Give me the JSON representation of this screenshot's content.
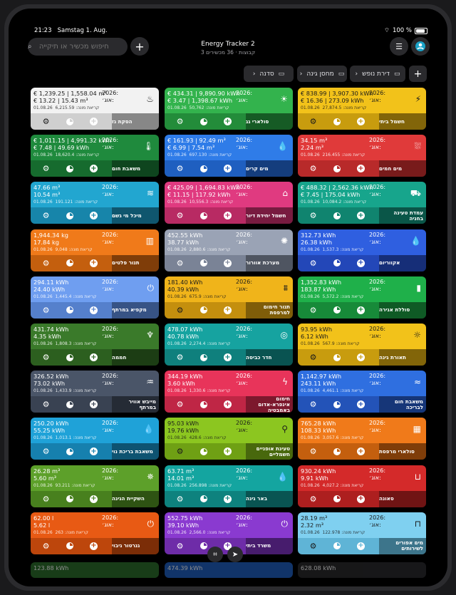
{
  "status": {
    "time": "21:23",
    "date": "Samstag 1. Aug.",
    "battery": "100 %",
    "wifi_icon": "wifi-icon",
    "battery_icon": "battery-icon"
  },
  "header": {
    "title": "Energy Tracker 2",
    "subtitle": "3 קבוצות · 36 מכשירים",
    "search_placeholder": "חיפוש מכשיר או תיקייה"
  },
  "folders": [
    {
      "label": "דירת נופש"
    },
    {
      "label": "מחסן גינה"
    },
    {
      "label": "סדנה"
    }
  ],
  "common": {
    "year_label": "2026:",
    "month_label": "אוג׳:",
    "date": "01.08.26",
    "reading_label": "קריאת מונה:"
  },
  "cards": [
    {
      "name": "הסקת גז",
      "v1": "€ 1,239.25 | 1,558.04 m³",
      "v2": "€ 13.22 | 15.43 m³",
      "reading": "6,215.59",
      "icon": "flame-icon",
      "color_top": "#f2f2f2",
      "color_bottom": "#cfcfcf",
      "dark": true
    },
    {
      "name": "סולארי גג",
      "v1": "€ 434.31 | 9,890.90 kWh",
      "v2": "€ 3.47 | 1,398.67 kWh",
      "reading": "50,762",
      "icon": "sun-icon",
      "color_top": "#33b34d",
      "color_bottom": "#238c3a"
    },
    {
      "name": "חשמל ביתי",
      "v1": "€ 838.99 | 3,907.30 kWh",
      "v2": "€ 16.36 | 273.09 kWh",
      "reading": "27,874.5",
      "icon": "bolt-icon",
      "color_top": "#f2c21a",
      "color_bottom": "#c89c0e",
      "dark": true
    },
    {
      "name": "משאבת חום",
      "v1": "€ 1,011.15 | 4,991.32 kWh",
      "v2": "€ 7.48 | 49.69 kWh",
      "reading": "18,620.4",
      "icon": "thermometer-icon",
      "color_top": "#1f8a3d",
      "color_bottom": "#166b2e"
    },
    {
      "name": "מים קרים",
      "v1": "€ 161.93 | 92.49 m³",
      "v2": "€ 6.99 | 7.54 m³",
      "reading": "697.130",
      "icon": "water-drops-icon",
      "color_top": "#2f7ce8",
      "color_bottom": "#1f5fc0"
    },
    {
      "name": "מים חמים",
      "v1": "34.15 m³",
      "v2": "2.24 m³",
      "reading": "216.455",
      "icon": "shower-icon",
      "color_top": "#e03a3a",
      "color_bottom": "#b82a2a"
    },
    {
      "name": "מיכל מי גשם",
      "v1": "47.66 m³",
      "v2": "10.54 m³",
      "reading": "191.121",
      "icon": "waves-icon",
      "color_top": "#22a6d0",
      "color_bottom": "#1785aa"
    },
    {
      "name": "חשמל יחידת דיור",
      "v1": "€ 425.09 | 1,694.83 kWh",
      "v2": "€ 11.15 | 117.92 kWh",
      "reading": "10,556.3",
      "icon": "house-icon",
      "color_top": "#e03a80",
      "color_bottom": "#b82a63"
    },
    {
      "name": "עמדת טעינה בחניה",
      "v1": "€ 488.32 | 2,562.36 kWh",
      "v2": "€ 7.45 | 175.04 kWh",
      "reading": "10,084.2",
      "icon": "car-icon",
      "color_top": "#17a58c",
      "color_bottom": "#10846f"
    },
    {
      "name": "תנור פלטים",
      "v1": "1,944.34 kg",
      "v2": "17.84 kg",
      "reading": "9,048",
      "icon": "pellet-stove-icon",
      "color_top": "#f07a1a",
      "color_bottom": "#c45f0e"
    },
    {
      "name": "מערכת אוורור",
      "v1": "452.55 kWh",
      "v2": "38.77 kWh",
      "reading": "2,880.6",
      "icon": "fan-icon",
      "color_top": "#9aa3b5",
      "color_bottom": "#7a8396"
    },
    {
      "name": "אקווריום",
      "v1": "312.73 kWh",
      "v2": "26.38 kWh",
      "reading": "1,537.3",
      "icon": "drop-icon",
      "color_top": "#2f5fe0",
      "color_bottom": "#2347b8"
    },
    {
      "name": "מקפיא במרתף",
      "v1": "294.11 kWh",
      "v2": "24.40 kWh",
      "reading": "1,445.4",
      "icon": "plug-icon",
      "color_top": "#6f9ef0",
      "color_bottom": "#5580cc"
    },
    {
      "name": "תנור חימום למרפסת",
      "v1": "181.40 kWh",
      "v2": "40.39 kWh",
      "reading": "675.9",
      "icon": "heater-icon",
      "color_top": "#f0b41a",
      "color_bottom": "#c48f0e",
      "dark": true
    },
    {
      "name": "סוללת אגירה",
      "v1": "1,352.83 kWh",
      "v2": "183.87 kWh",
      "reading": "5,572.2",
      "icon": "battery-icon",
      "color_top": "#1fb04a",
      "color_bottom": "#178a39"
    },
    {
      "name": "חממה",
      "v1": "431.74 kWh",
      "v2": "4.35 kWh",
      "reading": "1,808.3",
      "icon": "lamp-icon",
      "color_top": "#3a7a2a",
      "color_bottom": "#2c5f1f"
    },
    {
      "name": "חדר כביסה",
      "v1": "478.07 kWh",
      "v2": "40.78 kWh",
      "reading": "2,274.4",
      "icon": "laundry-icon",
      "color_top": "#16a3a0",
      "color_bottom": "#0f807d"
    },
    {
      "name": "תאורת גינה",
      "v1": "93.95 kWh",
      "v2": "6.12 kWh",
      "reading": "567.9",
      "icon": "bulb-icon",
      "color_top": "#f2c21a",
      "color_bottom": "#c89c0e",
      "dark": true
    },
    {
      "name": "מייבש אוויר במרתף",
      "v1": "326.52 kWh",
      "v2": "73.02 kWh",
      "reading": "1,433.9",
      "icon": "dehumidifier-icon",
      "color_top": "#4a5568",
      "color_bottom": "#394252"
    },
    {
      "name": "חימום אינפרא-אדום באמבטיה",
      "v1": "344.19 kWh",
      "v2": "3.60 kWh",
      "reading": "1,330.6",
      "icon": "lightning-icon",
      "color_top": "#e8345a",
      "color_bottom": "#bf2645"
    },
    {
      "name": "משאבת חום לבריכה",
      "v1": "1,142.97 kWh",
      "v2": "243.11 kWh",
      "reading": "4,461.1",
      "icon": "pool-icon",
      "color_top": "#2f6fe0",
      "color_bottom": "#2353b8"
    },
    {
      "name": "משאבת בריכת נוי",
      "v1": "250.20 kWh",
      "v2": "55.25 kWh",
      "reading": "1,013.1",
      "icon": "drop-icon",
      "color_top": "#1fa2d8",
      "color_bottom": "#1680ae"
    },
    {
      "name": "טעינת אופניים חשמליים",
      "v1": "95.03 kWh",
      "v2": "19.76 kWh",
      "reading": "428.6",
      "icon": "bicycle-icon",
      "color_top": "#8cc620",
      "color_bottom": "#6fa014",
      "dark": true
    },
    {
      "name": "סולארי מרפסת",
      "v1": "765.28 kWh",
      "v2": "108.33 kWh",
      "reading": "3,057.6",
      "icon": "solar-panel-icon",
      "color_top": "#f07a1a",
      "color_bottom": "#c45f0e"
    },
    {
      "name": "השקיית הגינה",
      "v1": "26.28 m³",
      "v2": "5.60 m³",
      "reading": "93.211",
      "icon": "sprinkler-icon",
      "color_top": "#5da02a",
      "color_bottom": "#48801e"
    },
    {
      "name": "באר גינה",
      "v1": "63.71 m³",
      "v2": "14.01 m³",
      "reading": "256.898",
      "icon": "water-drops-icon",
      "color_top": "#14a5a0",
      "color_bottom": "#0e827e"
    },
    {
      "name": "סאונה",
      "v1": "930.24 kWh",
      "v2": "9.91 kWh",
      "reading": "4,027.2",
      "icon": "bathtub-icon",
      "color_top": "#d42a2a",
      "color_bottom": "#ad1f1f"
    },
    {
      "name": "גנרטור גיבוי",
      "v1": "62.00 l",
      "v2": "5.62 l",
      "reading": "263",
      "icon": "power-icon",
      "color_top": "#e85a14",
      "color_bottom": "#bd460c"
    },
    {
      "name": "משרד ביתי",
      "v1": "552.75 kWh",
      "v2": "39.10 kWh",
      "reading": "2,566.0",
      "icon": "plug-icon",
      "color_top": "#8a3ad0",
      "color_bottom": "#6e2ca8"
    },
    {
      "name": "מים אפורים לשירותים",
      "v1": "28.19 m³",
      "v2": "2.32 m³",
      "reading": "122.978",
      "icon": "toilet-icon",
      "color_top": "#7fd0f0",
      "color_bottom": "#5fb4d6",
      "dark": true
    }
  ],
  "partial_row": {
    "cells": [
      {
        "v1": "123.88 kWh",
        "color": "#2c6e2c"
      },
      {
        "v1": "474.39 kWh",
        "color": "#1f5fc0"
      },
      {
        "v1": "628.08 kWh",
        "color": "#2a2a2d"
      }
    ]
  },
  "dock": {
    "scan_icon": "scan-icon",
    "location_icon": "location-arrow-icon"
  }
}
